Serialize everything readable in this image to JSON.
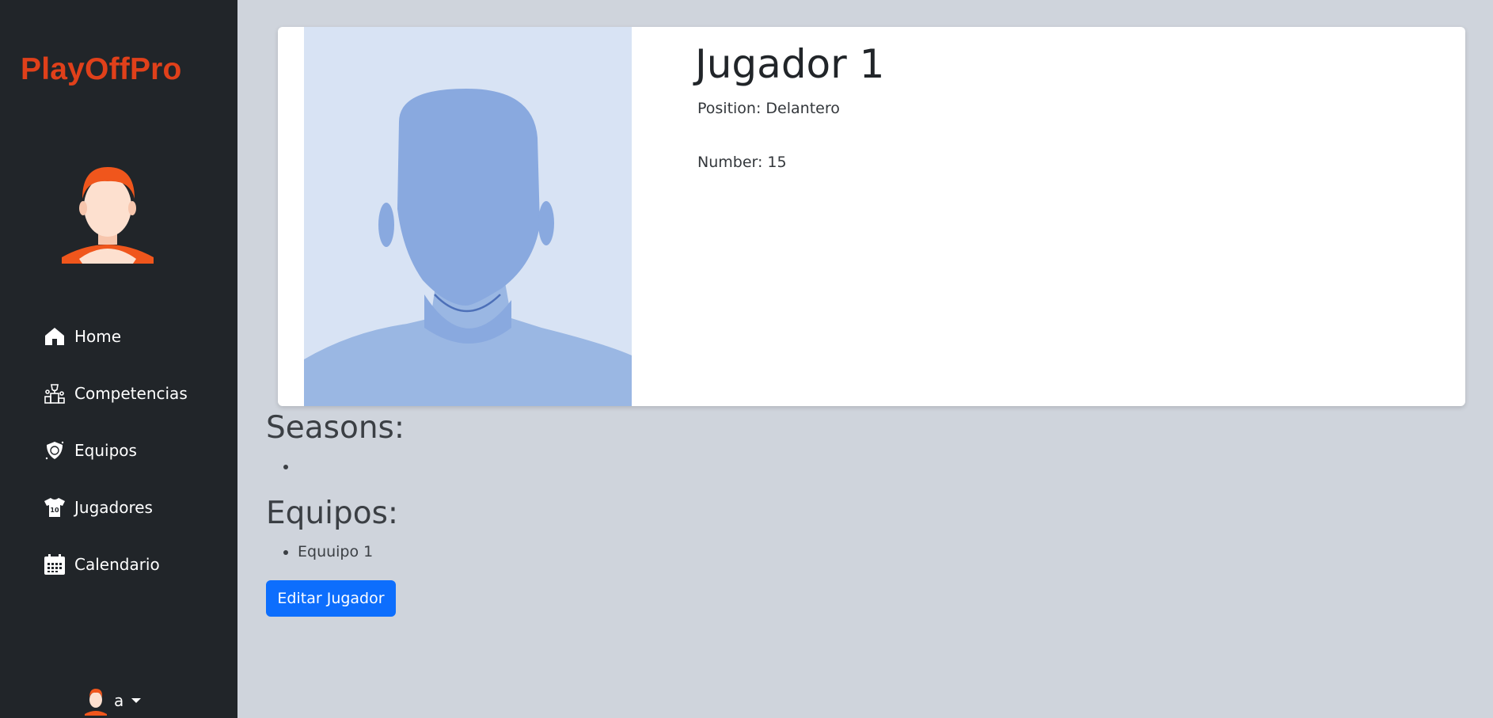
{
  "sidebar": {
    "brand": "PlayOffPro",
    "items": [
      {
        "label": "Home",
        "icon": "home-icon"
      },
      {
        "label": "Competencias",
        "icon": "trophy-podium-icon"
      },
      {
        "label": "Equipos",
        "icon": "shield-ball-icon"
      },
      {
        "label": "Jugadores",
        "icon": "jersey-icon"
      },
      {
        "label": "Calendario",
        "icon": "calendar-icon"
      }
    ],
    "user": {
      "name": "a",
      "icon": "user-avatar-icon"
    }
  },
  "player": {
    "name": "Jugador 1",
    "position": "Position: Delantero",
    "number": "Number: 15"
  },
  "seasons": {
    "heading": "Seasons:",
    "items": [
      ""
    ]
  },
  "equipos": {
    "heading": "Equipos:",
    "items": [
      "Equuipo 1"
    ]
  },
  "actions": {
    "edit_label": "Editar Jugador"
  },
  "colors": {
    "brand": "#e0401a",
    "sidebar_bg": "#212529",
    "page_bg": "#cfd4dc",
    "primary": "#0d6efd"
  }
}
